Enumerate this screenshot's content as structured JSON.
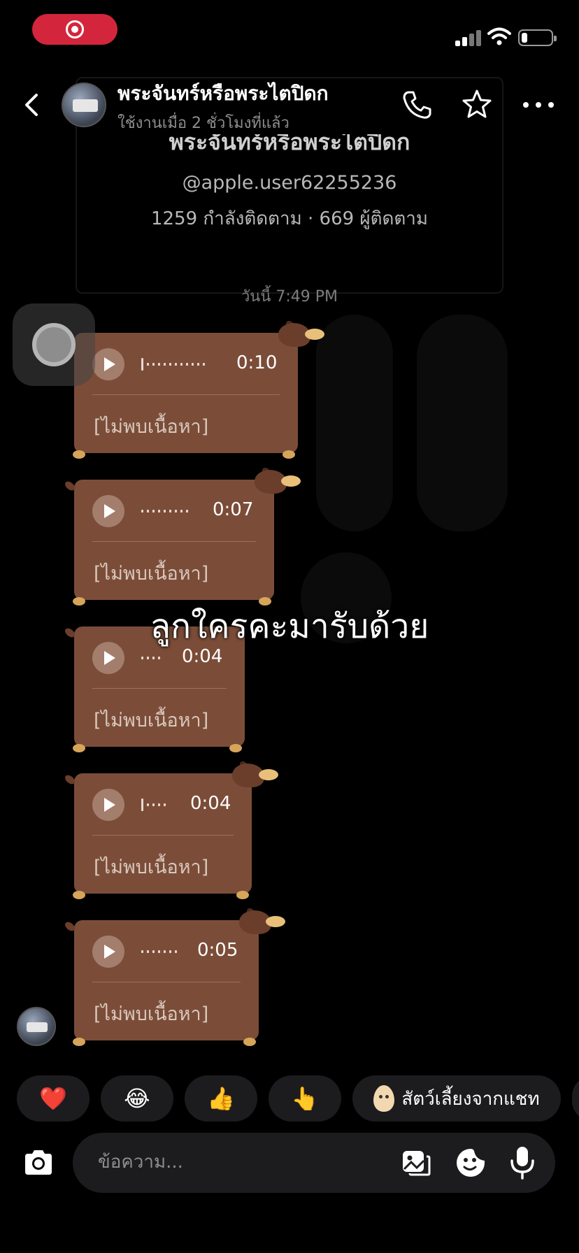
{
  "status_bar": {
    "recording_indicator": "screen-record-icon",
    "signal_icon": "cellular-signal-icon",
    "wifi_icon": "wifi-icon",
    "battery_icon": "battery-icon",
    "battery_level": 0.2
  },
  "header": {
    "name": "พระจันทร์หรือพระไตปิดก",
    "status": "ใช้งานเมื่อ 2 ชั่วโมงที่แล้ว",
    "icons": [
      "back-icon",
      "phone-icon",
      "star-icon",
      "more-icon"
    ]
  },
  "profile": {
    "name": "พระจันทร์หรือพระไตปิดก",
    "handle": "@apple.user62255236",
    "stats": "1259 กำลังติดตาม · 669 ผู้ติดตาม"
  },
  "conversation": {
    "date_separator": "วันนี้ 7:49 PM",
    "messages": [
      {
        "duration": "0:10",
        "caption": "[ไม่พบเนื้อหา]"
      },
      {
        "duration": "0:07",
        "caption": "[ไม่พบเนื้อหา]"
      },
      {
        "duration": "0:04",
        "caption": "[ไม่พบเนื้อหา]"
      },
      {
        "duration": "0:04",
        "caption": "[ไม่พบเนื้อหา]"
      },
      {
        "duration": "0:05",
        "caption": "[ไม่พบเนื้อหา]"
      }
    ]
  },
  "overlay_caption": "ลูกใครคะมารับด้วย",
  "quick_reactions": {
    "emojis": [
      "❤️",
      "😂",
      "👍",
      "👆"
    ],
    "pet_chip_label": "สัตว์เลี้ยงจากแชท"
  },
  "composer": {
    "placeholder": "ข้อความ...",
    "icons": [
      "camera-icon",
      "gallery-icon",
      "sticker-icon",
      "microphone-icon"
    ]
  },
  "colors": {
    "background": "#000000",
    "bubble": "#7b4d38",
    "chip": "#1c1c1e",
    "record_pill": "#d3263c"
  }
}
